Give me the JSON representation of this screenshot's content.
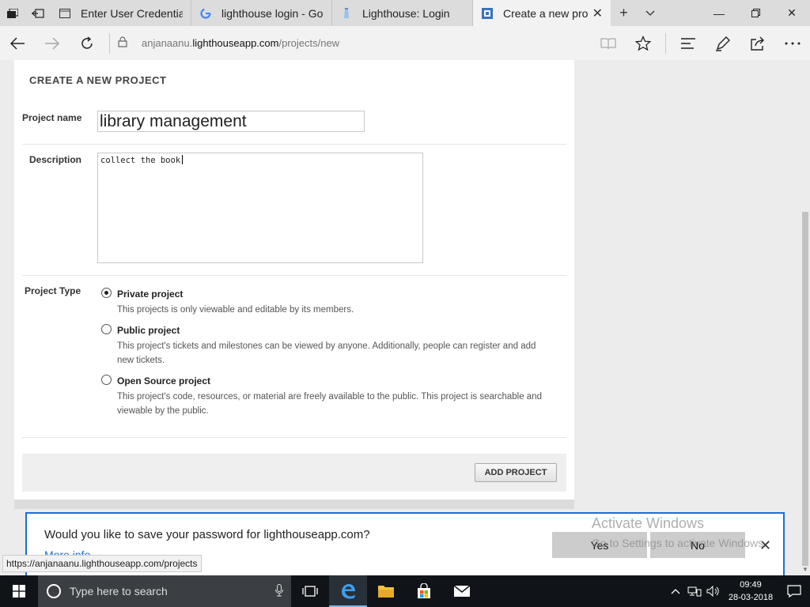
{
  "browser": {
    "tabs": [
      {
        "label": "Enter User Credentials",
        "active": false
      },
      {
        "label": "lighthouse login - Goog",
        "active": false
      },
      {
        "label": "Lighthouse: Login",
        "active": false
      },
      {
        "label": "Create a new projec",
        "active": true
      }
    ],
    "address": {
      "prefix": "anjanaanu.",
      "host": "lighthouseapp.com",
      "path": "/projects/new"
    }
  },
  "form": {
    "heading": "CREATE A NEW PROJECT",
    "name_label": "Project name",
    "name_value": "library management",
    "description_label": "Description",
    "description_value": "collect the book",
    "type_label": "Project Type",
    "options": [
      {
        "title": "Private project",
        "desc": "This projects is only viewable and editable by its members.",
        "selected": true
      },
      {
        "title": "Public project",
        "desc": "This project's tickets and milestones can be viewed by anyone. Additionally, people can register and add new tickets.",
        "selected": false
      },
      {
        "title": "Open Source project",
        "desc": "This project's code, resources, or material are freely available to the public. This project is searchable and viewable by the public.",
        "selected": false
      }
    ],
    "submit_label": "ADD PROJECT"
  },
  "save_password": {
    "question": "Would you like to save your password for lighthouseapp.com?",
    "more_info": "More info",
    "yes_label": "Yes",
    "no_label": "No"
  },
  "watermark": {
    "line1": "Activate Windows",
    "line2": "Go to Settings to activate Windows."
  },
  "status_url": "https://anjanaanu.lighthouseapp.com/projects",
  "taskbar": {
    "search_placeholder": "Type here to search",
    "time": "09:49",
    "date": "28-03-2018"
  },
  "colors": {
    "accent": "#1a6fd6",
    "taskbar": "#101418"
  }
}
